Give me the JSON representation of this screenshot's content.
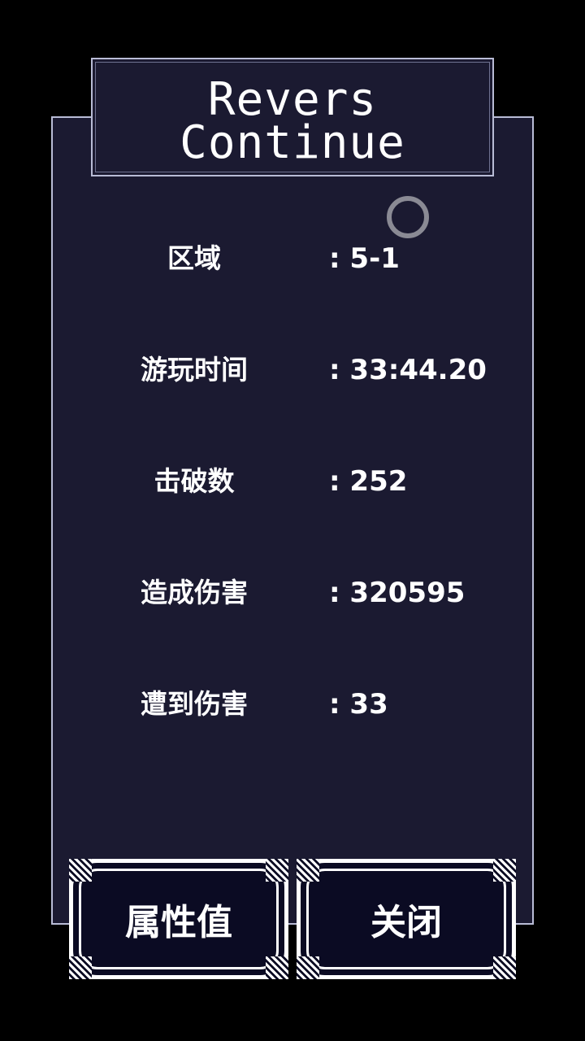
{
  "title": {
    "line1": "Revers",
    "line2": "Continue"
  },
  "stats": [
    {
      "label": "区域",
      "value": ": 5-1"
    },
    {
      "label": "游玩时间",
      "value": ": 33:44.20"
    },
    {
      "label": "击破数",
      "value": ": 252"
    },
    {
      "label": "造成伤害",
      "value": ": 320595"
    },
    {
      "label": "遭到伤害",
      "value": ": 33"
    }
  ],
  "buttons": {
    "stats_label": "属性值",
    "close_label": "关闭"
  },
  "colors": {
    "panel": "#1b1a31",
    "border": "#b9bcd6",
    "button_fill": "#0b0b23",
    "text": "#ffffff"
  }
}
